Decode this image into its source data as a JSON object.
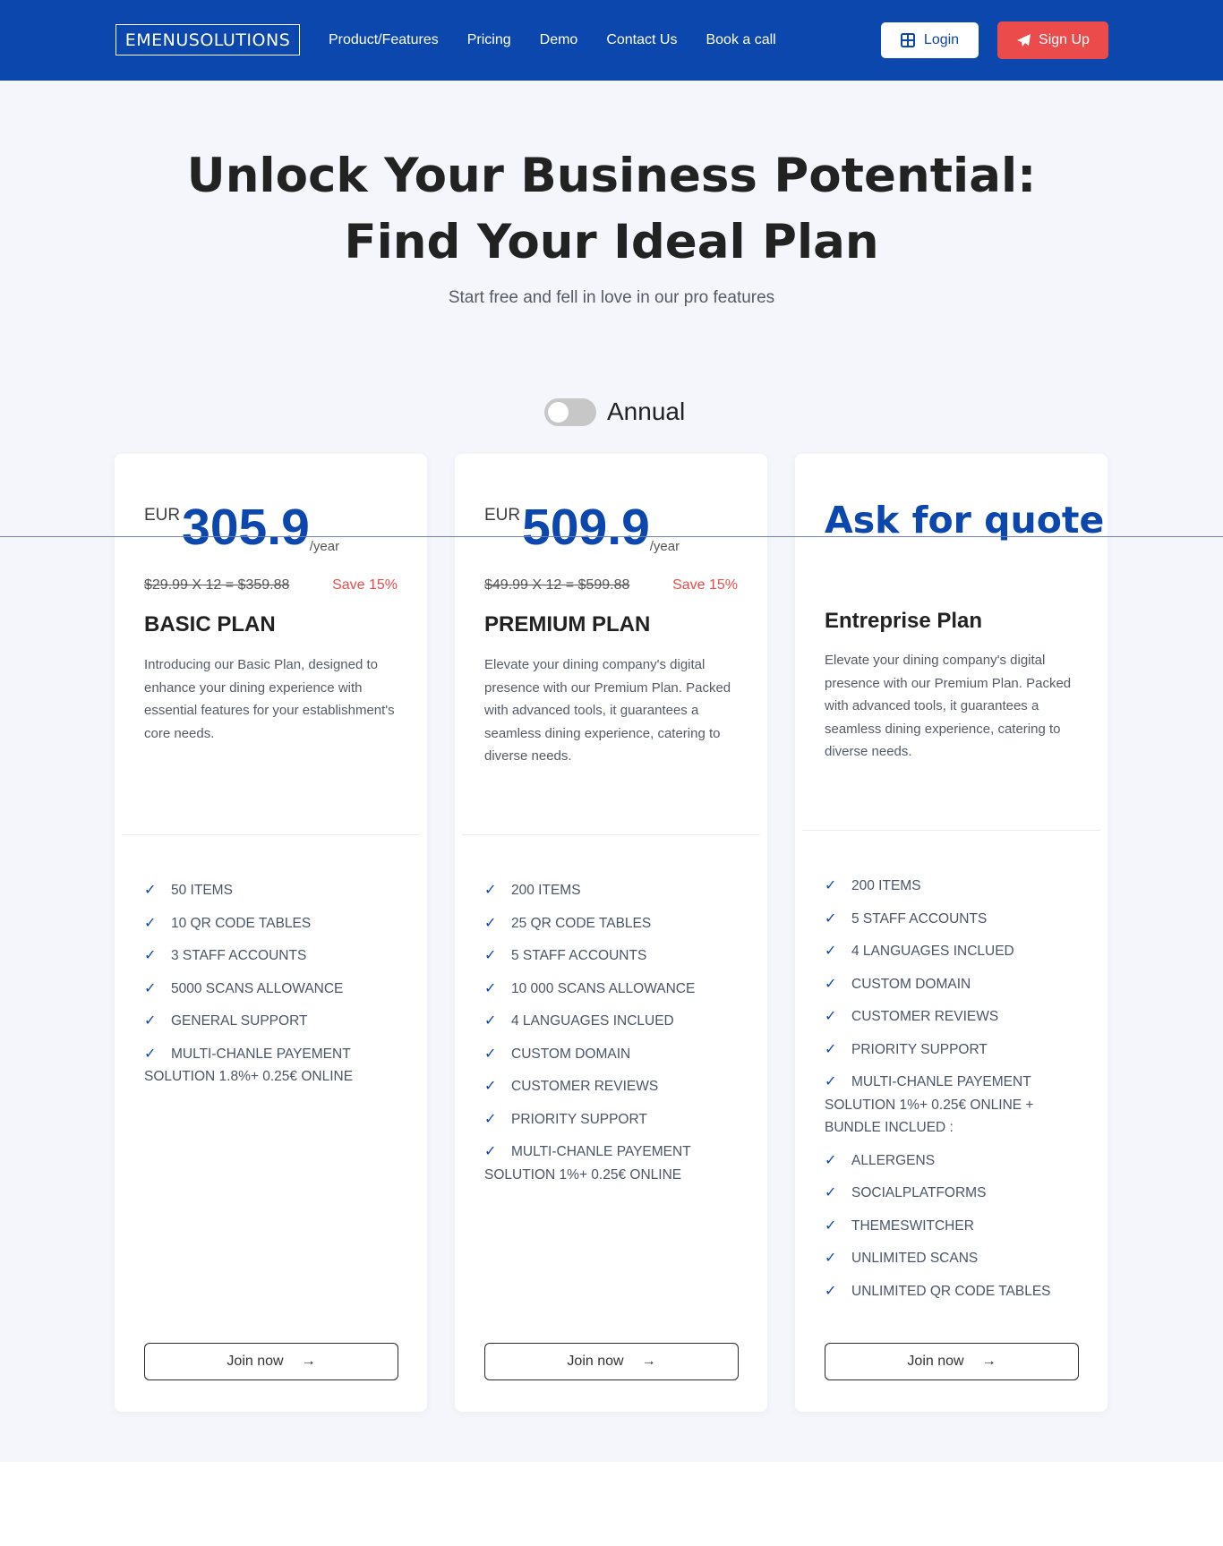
{
  "nav": {
    "logo": "EMENUSOLUTIONS",
    "links": [
      "Product/Features",
      "Pricing",
      "Demo",
      "Contact Us",
      "Book a call"
    ],
    "login_label": "Login",
    "signup_label": "Sign Up"
  },
  "hero": {
    "title_line1": "Unlock Your Business Potential:",
    "title_line2": "Find Your Ideal Plan",
    "subtitle": "Start free and fell in love in our pro features"
  },
  "toggle": {
    "label": "Annual",
    "on": false
  },
  "plans": [
    {
      "currency": "EUR",
      "amount": "305.9",
      "per": "/year",
      "original": "$29.99 X 12 = $359.88",
      "save": "Save 15%",
      "name": "BASIC PLAN",
      "description": "Introducing our Basic Plan, designed to enhance your dining experience with essential features for your establishment's core needs.",
      "features": [
        "50 ITEMS",
        "10 QR CODE TABLES",
        "3 STAFF ACCOUNTS",
        "5000 SCANS ALLOWANCE",
        "GENERAL SUPPORT",
        "MULTI-CHANLE PAYEMENT SOLUTION 1.8%+ 0.25€ ONLINE"
      ],
      "cta": "Join now"
    },
    {
      "currency": "EUR",
      "amount": "509.9",
      "per": "/year",
      "original": "$49.99 X 12 = $599.88",
      "save": "Save 15%",
      "name": "PREMIUM PLAN",
      "description": "Elevate your dining company's digital presence with our Premium Plan. Packed with advanced tools, it guarantees a seamless dining experience, catering to diverse needs.",
      "features": [
        "200 ITEMS",
        "25 QR CODE TABLES",
        "5 STAFF ACCOUNTS",
        "10 000 SCANS ALLOWANCE",
        "4 LANGUAGES INCLUED",
        "CUSTOM DOMAIN",
        "CUSTOMER REVIEWS",
        "PRIORITY SUPPORT",
        "MULTI-CHANLE PAYEMENT SOLUTION 1%+ 0.25€ ONLINE"
      ],
      "cta": "Join now"
    },
    {
      "quote": "Ask for quote",
      "name": "Entreprise Plan",
      "description": "Elevate your dining company's digital presence with our Premium Plan. Packed with advanced tools, it guarantees a seamless dining experience, catering to diverse needs.",
      "features": [
        "200 ITEMS",
        "5 STAFF ACCOUNTS",
        "4 LANGUAGES INCLUED",
        "CUSTOM DOMAIN",
        "CUSTOMER REVIEWS",
        "PRIORITY SUPPORT",
        "MULTI-CHANLE PAYEMENT SOLUTION 1%+ 0.25€ ONLINE + BUNDLE INCLUED :",
        "ALLERGENS",
        "SOCIALPLATFORMS",
        "THEMESWITCHER",
        "UNLIMITED SCANS",
        "UNLIMITED QR CODE TABLES"
      ],
      "cta": "Join now"
    }
  ],
  "colors": {
    "brand": "#0c47ad",
    "accent": "#ec4b4b",
    "background": "#f4f6fb"
  },
  "icons": {
    "login": "grid-icon",
    "signup": "paper-plane-icon",
    "check": "check-icon",
    "arrow": "arrow-right-icon"
  }
}
